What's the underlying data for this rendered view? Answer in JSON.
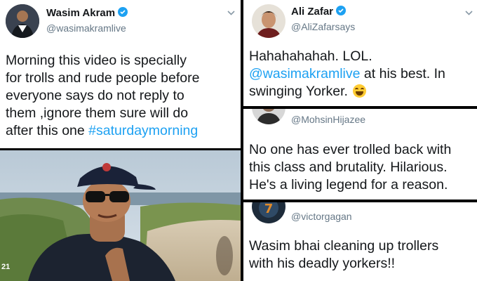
{
  "tweet1": {
    "name": "Wasim Akram",
    "handle": "@wasimakramlive",
    "lines": [
      "Morning this video is specially",
      "for trolls and rude people before",
      "everyone says do not reply to",
      "them ,ignore them sure will do"
    ],
    "last_line_text": "after this one",
    "hashtag": "#saturdaymorning"
  },
  "video": {
    "timestamp": "21"
  },
  "tweet2": {
    "name": "Ali Zafar",
    "handle": "@AliZafarsays",
    "line1": "Hahahahahah. LOL.",
    "mention": "@wasimakramlive",
    "line2_rest": "at his best. In",
    "line3": "swinging Yorker."
  },
  "tweet3": {
    "handle": "@MohsinHijazee",
    "lines": [
      "No one has ever trolled back with",
      "this class and brutality. Hilarious.",
      "He's a living legend for a reason."
    ]
  },
  "tweet4": {
    "handle": "@victorgagan",
    "lines": [
      "Wasim bhai cleaning up trollers",
      "with his deadly yorkers!!"
    ]
  },
  "icons": {
    "verified": "verified-badge-icon",
    "chevron": "chevron-down-icon",
    "emoji": "tears-of-joy-emoji-icon"
  },
  "colors": {
    "link": "#1da1f2",
    "handle": "#657786",
    "text": "#14171a"
  }
}
